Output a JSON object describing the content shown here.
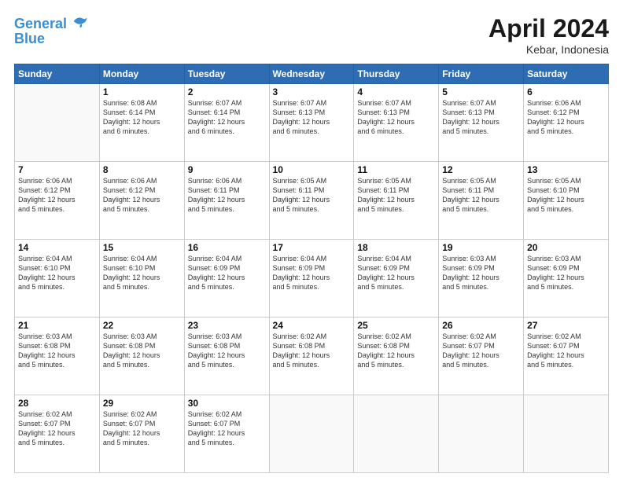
{
  "header": {
    "logo_line1": "General",
    "logo_line2": "Blue",
    "month": "April 2024",
    "location": "Kebar, Indonesia"
  },
  "days_of_week": [
    "Sunday",
    "Monday",
    "Tuesday",
    "Wednesday",
    "Thursday",
    "Friday",
    "Saturday"
  ],
  "weeks": [
    [
      {
        "day": "",
        "info": ""
      },
      {
        "day": "1",
        "info": "Sunrise: 6:08 AM\nSunset: 6:14 PM\nDaylight: 12 hours\nand 6 minutes."
      },
      {
        "day": "2",
        "info": "Sunrise: 6:07 AM\nSunset: 6:14 PM\nDaylight: 12 hours\nand 6 minutes."
      },
      {
        "day": "3",
        "info": "Sunrise: 6:07 AM\nSunset: 6:13 PM\nDaylight: 12 hours\nand 6 minutes."
      },
      {
        "day": "4",
        "info": "Sunrise: 6:07 AM\nSunset: 6:13 PM\nDaylight: 12 hours\nand 6 minutes."
      },
      {
        "day": "5",
        "info": "Sunrise: 6:07 AM\nSunset: 6:13 PM\nDaylight: 12 hours\nand 5 minutes."
      },
      {
        "day": "6",
        "info": "Sunrise: 6:06 AM\nSunset: 6:12 PM\nDaylight: 12 hours\nand 5 minutes."
      }
    ],
    [
      {
        "day": "7",
        "info": "Sunrise: 6:06 AM\nSunset: 6:12 PM\nDaylight: 12 hours\nand 5 minutes."
      },
      {
        "day": "8",
        "info": "Sunrise: 6:06 AM\nSunset: 6:12 PM\nDaylight: 12 hours\nand 5 minutes."
      },
      {
        "day": "9",
        "info": "Sunrise: 6:06 AM\nSunset: 6:11 PM\nDaylight: 12 hours\nand 5 minutes."
      },
      {
        "day": "10",
        "info": "Sunrise: 6:05 AM\nSunset: 6:11 PM\nDaylight: 12 hours\nand 5 minutes."
      },
      {
        "day": "11",
        "info": "Sunrise: 6:05 AM\nSunset: 6:11 PM\nDaylight: 12 hours\nand 5 minutes."
      },
      {
        "day": "12",
        "info": "Sunrise: 6:05 AM\nSunset: 6:11 PM\nDaylight: 12 hours\nand 5 minutes."
      },
      {
        "day": "13",
        "info": "Sunrise: 6:05 AM\nSunset: 6:10 PM\nDaylight: 12 hours\nand 5 minutes."
      }
    ],
    [
      {
        "day": "14",
        "info": "Sunrise: 6:04 AM\nSunset: 6:10 PM\nDaylight: 12 hours\nand 5 minutes."
      },
      {
        "day": "15",
        "info": "Sunrise: 6:04 AM\nSunset: 6:10 PM\nDaylight: 12 hours\nand 5 minutes."
      },
      {
        "day": "16",
        "info": "Sunrise: 6:04 AM\nSunset: 6:09 PM\nDaylight: 12 hours\nand 5 minutes."
      },
      {
        "day": "17",
        "info": "Sunrise: 6:04 AM\nSunset: 6:09 PM\nDaylight: 12 hours\nand 5 minutes."
      },
      {
        "day": "18",
        "info": "Sunrise: 6:04 AM\nSunset: 6:09 PM\nDaylight: 12 hours\nand 5 minutes."
      },
      {
        "day": "19",
        "info": "Sunrise: 6:03 AM\nSunset: 6:09 PM\nDaylight: 12 hours\nand 5 minutes."
      },
      {
        "day": "20",
        "info": "Sunrise: 6:03 AM\nSunset: 6:09 PM\nDaylight: 12 hours\nand 5 minutes."
      }
    ],
    [
      {
        "day": "21",
        "info": "Sunrise: 6:03 AM\nSunset: 6:08 PM\nDaylight: 12 hours\nand 5 minutes."
      },
      {
        "day": "22",
        "info": "Sunrise: 6:03 AM\nSunset: 6:08 PM\nDaylight: 12 hours\nand 5 minutes."
      },
      {
        "day": "23",
        "info": "Sunrise: 6:03 AM\nSunset: 6:08 PM\nDaylight: 12 hours\nand 5 minutes."
      },
      {
        "day": "24",
        "info": "Sunrise: 6:02 AM\nSunset: 6:08 PM\nDaylight: 12 hours\nand 5 minutes."
      },
      {
        "day": "25",
        "info": "Sunrise: 6:02 AM\nSunset: 6:08 PM\nDaylight: 12 hours\nand 5 minutes."
      },
      {
        "day": "26",
        "info": "Sunrise: 6:02 AM\nSunset: 6:07 PM\nDaylight: 12 hours\nand 5 minutes."
      },
      {
        "day": "27",
        "info": "Sunrise: 6:02 AM\nSunset: 6:07 PM\nDaylight: 12 hours\nand 5 minutes."
      }
    ],
    [
      {
        "day": "28",
        "info": "Sunrise: 6:02 AM\nSunset: 6:07 PM\nDaylight: 12 hours\nand 5 minutes."
      },
      {
        "day": "29",
        "info": "Sunrise: 6:02 AM\nSunset: 6:07 PM\nDaylight: 12 hours\nand 5 minutes."
      },
      {
        "day": "30",
        "info": "Sunrise: 6:02 AM\nSunset: 6:07 PM\nDaylight: 12 hours\nand 5 minutes."
      },
      {
        "day": "",
        "info": ""
      },
      {
        "day": "",
        "info": ""
      },
      {
        "day": "",
        "info": ""
      },
      {
        "day": "",
        "info": ""
      }
    ]
  ]
}
